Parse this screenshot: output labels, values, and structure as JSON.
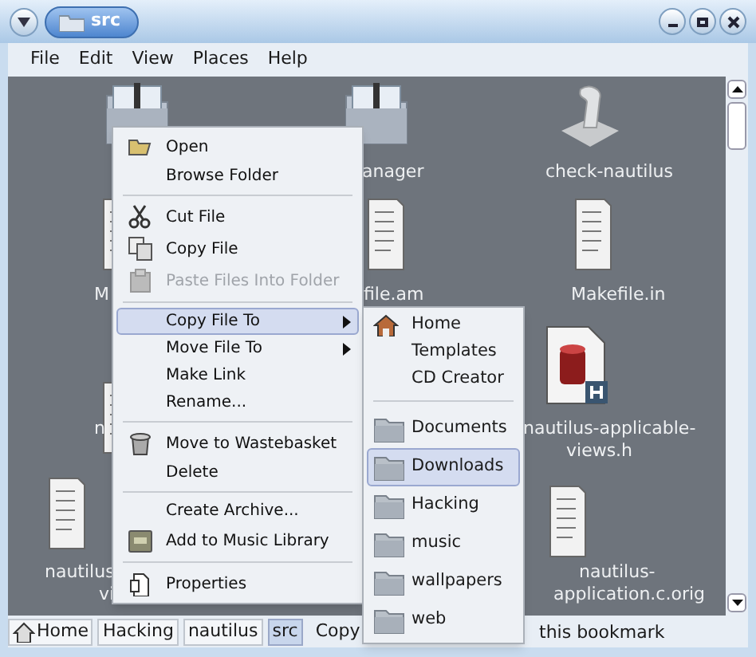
{
  "window": {
    "title": "src"
  },
  "menubar": [
    {
      "label": "File"
    },
    {
      "label": "Edit"
    },
    {
      "label": "View"
    },
    {
      "label": "Places"
    },
    {
      "label": "Help"
    }
  ],
  "icons": [
    {
      "kind": "folder"
    },
    {
      "kind": "folder",
      "lines": [
        "anager"
      ]
    },
    {
      "kind": "script",
      "lines": [
        "check-nautilus"
      ]
    },
    {
      "kind": "document",
      "lines": [
        "M"
      ]
    },
    {
      "kind": "document",
      "lines": [
        "file.am"
      ]
    },
    {
      "kind": "document",
      "lines": [
        "Makefile.in"
      ]
    },
    {
      "kind": "document",
      "lines": [
        "n"
      ]
    },
    {
      "kind": "header",
      "lines": [
        "nautilus-applicable-",
        "views.h"
      ]
    },
    {
      "kind": "document",
      "lines": [
        "nautilus",
        "vi"
      ]
    },
    {
      "kind": "document",
      "lines": [
        "nautilus-",
        "application.c.orig"
      ]
    }
  ],
  "context_menu": [
    {
      "kind": "item",
      "label": "Open",
      "disabled": false,
      "selected": false,
      "submenu": false
    },
    {
      "kind": "item",
      "label": "Browse Folder",
      "disabled": false,
      "selected": false,
      "submenu": false
    },
    {
      "kind": "separator"
    },
    {
      "kind": "item",
      "label": "Cut File",
      "disabled": false,
      "selected": false,
      "submenu": false
    },
    {
      "kind": "item",
      "label": "Copy File",
      "disabled": false,
      "selected": false,
      "submenu": false
    },
    {
      "kind": "item",
      "label": "Paste Files Into Folder",
      "disabled": true,
      "selected": false,
      "submenu": false
    },
    {
      "kind": "separator"
    },
    {
      "kind": "item",
      "label": "Copy File To",
      "disabled": false,
      "selected": true,
      "submenu": true
    },
    {
      "kind": "item",
      "label": "Move File To",
      "disabled": false,
      "selected": false,
      "submenu": true
    },
    {
      "kind": "item",
      "label": "Make Link",
      "disabled": false,
      "selected": false,
      "submenu": false
    },
    {
      "kind": "item",
      "label": "Rename...",
      "disabled": false,
      "selected": false,
      "submenu": false
    },
    {
      "kind": "separator"
    },
    {
      "kind": "item",
      "label": "Move to Wastebasket",
      "disabled": false,
      "selected": false,
      "submenu": false
    },
    {
      "kind": "item",
      "label": "Delete",
      "disabled": false,
      "selected": false,
      "submenu": false
    },
    {
      "kind": "separator"
    },
    {
      "kind": "item",
      "label": "Create Archive...",
      "disabled": false,
      "selected": false,
      "submenu": false
    },
    {
      "kind": "item",
      "label": "Add to Music Library",
      "disabled": false,
      "selected": false,
      "submenu": false
    },
    {
      "kind": "separator"
    },
    {
      "kind": "item",
      "label": "Properties",
      "disabled": false,
      "selected": false,
      "submenu": false
    }
  ],
  "submenu": [
    {
      "kind": "home",
      "label": "Home",
      "selected": false
    },
    {
      "kind": "plain",
      "label": "Templates",
      "selected": false
    },
    {
      "kind": "plain",
      "label": "CD Creator",
      "selected": false
    },
    {
      "kind": "separator"
    },
    {
      "kind": "folder",
      "label": "Documents",
      "selected": false
    },
    {
      "kind": "folder",
      "label": "Downloads",
      "selected": true
    },
    {
      "kind": "folder",
      "label": "Hacking",
      "selected": false
    },
    {
      "kind": "folder",
      "label": "music",
      "selected": false
    },
    {
      "kind": "folder",
      "label": "wallpapers",
      "selected": false
    },
    {
      "kind": "folder",
      "label": "web",
      "selected": false
    }
  ],
  "path_bar": [
    {
      "label": "Home",
      "kind": "home",
      "selected": false
    },
    {
      "label": "Hacking",
      "kind": "plain",
      "selected": false
    },
    {
      "label": "nautilus",
      "kind": "plain",
      "selected": false
    },
    {
      "label": "src",
      "kind": "plain",
      "selected": true
    }
  ],
  "status": [
    "Copy",
    "this bookmark"
  ]
}
